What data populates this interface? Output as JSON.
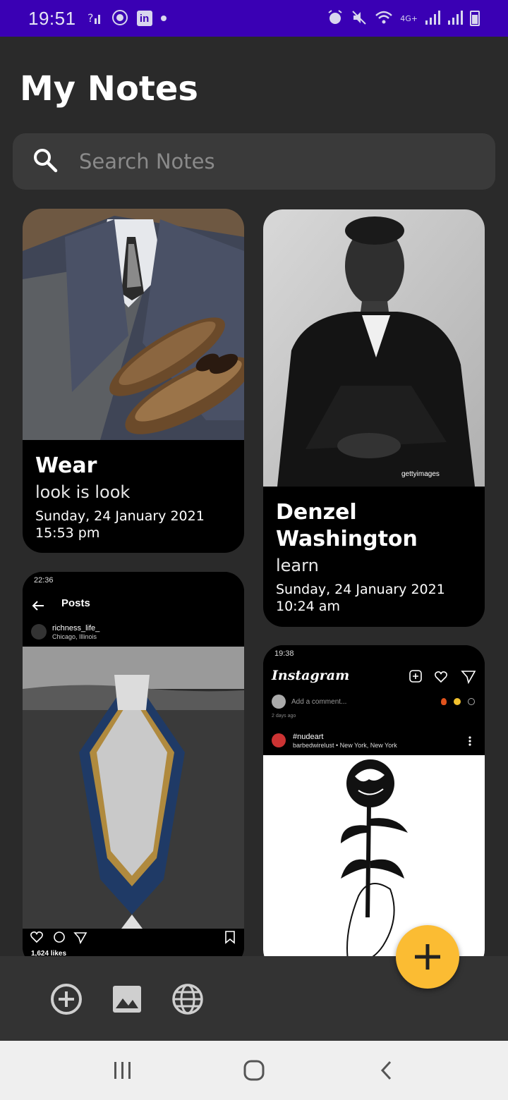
{
  "status_bar": {
    "time": "19:51",
    "linkedin_label": "in",
    "network": "4G+"
  },
  "header": {
    "title": "My Notes"
  },
  "search": {
    "placeholder": "Search Notes"
  },
  "notes": [
    {
      "title": "Wear",
      "subtitle": "look is look",
      "date": "Sunday, 24 January 2021 15:53 pm",
      "image": "suit-and-shoes-photo"
    },
    {
      "title": "Denzel Washington",
      "subtitle": "learn",
      "date": "Sunday, 24 January 2021 10:24 am",
      "image": "portrait-photo",
      "watermark": "gettyimages"
    },
    {
      "title": "",
      "image": "instagram-post-screenshot",
      "screenshot": {
        "time": "22:36",
        "header": "Posts",
        "username": "richness_life_",
        "location": "Chicago, Illinois",
        "likes": "1,624 likes"
      }
    },
    {
      "title": "",
      "image": "instagram-feed-screenshot",
      "screenshot": {
        "time": "19:38",
        "app_name": "Instagram",
        "comment_placeholder": "Add a comment...",
        "ago": "2 days ago",
        "hashtag": "#nudeart",
        "user_line": "barbedwirelust • New York, New York"
      }
    }
  ],
  "toolbar": {
    "buttons": [
      "add-circle-icon",
      "image-icon",
      "globe-icon"
    ]
  },
  "fab": {
    "icon": "plus-icon",
    "color": "#fbbc33"
  },
  "colors": {
    "status_bar": "#3a00b4",
    "background": "#2a2a2a",
    "card": "#000000",
    "accent": "#fbbc33"
  }
}
